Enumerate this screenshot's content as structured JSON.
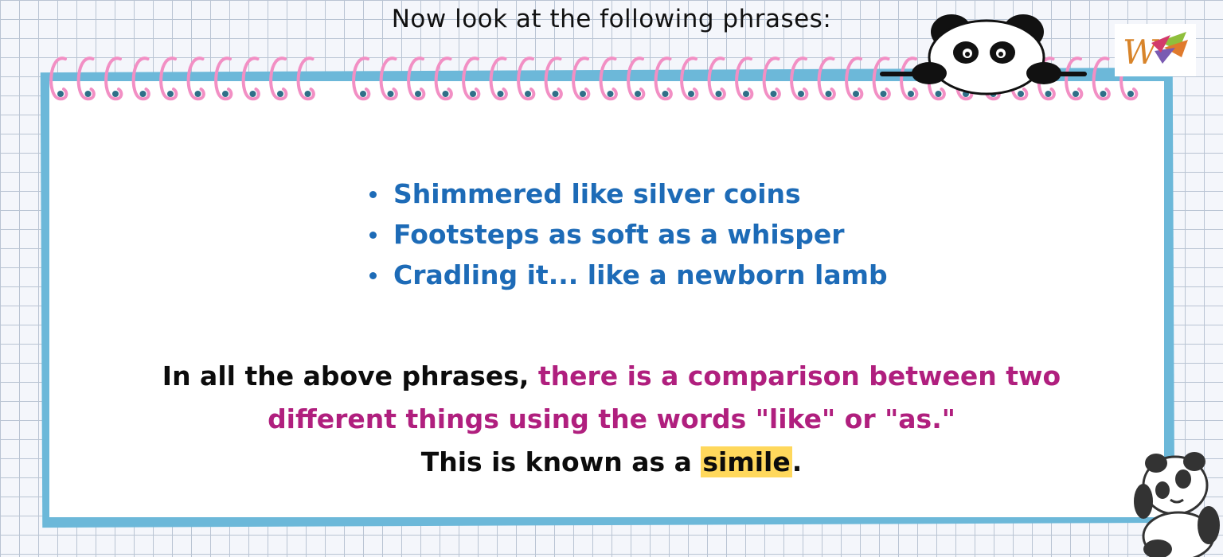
{
  "heading": "Now look at the following phrases:",
  "phrases": [
    "Shimmered like silver coins",
    "Footsteps as soft as a whisper",
    "Cradling it... like a newborn lamb"
  ],
  "explanation": {
    "lead": "In all the above phrases, ",
    "highlight": "there is a comparison between two different things using the words \"like\" or \"as.\"",
    "conclusion_prefix": "This is known as a ",
    "term": "simile",
    "conclusion_suffix": "."
  },
  "logo_text": "W",
  "colors": {
    "phrase_blue": "#1d6bb7",
    "highlight_pink": "#b01f7e",
    "term_highlight": "#ffd85c",
    "card_border": "#6cb8d9",
    "spiral_pink": "#f28fc4",
    "spiral_hole": "#2f6f88"
  },
  "icons": [
    "panda-peeking-icon",
    "panda-lying-icon",
    "brand-logo-icon"
  ]
}
